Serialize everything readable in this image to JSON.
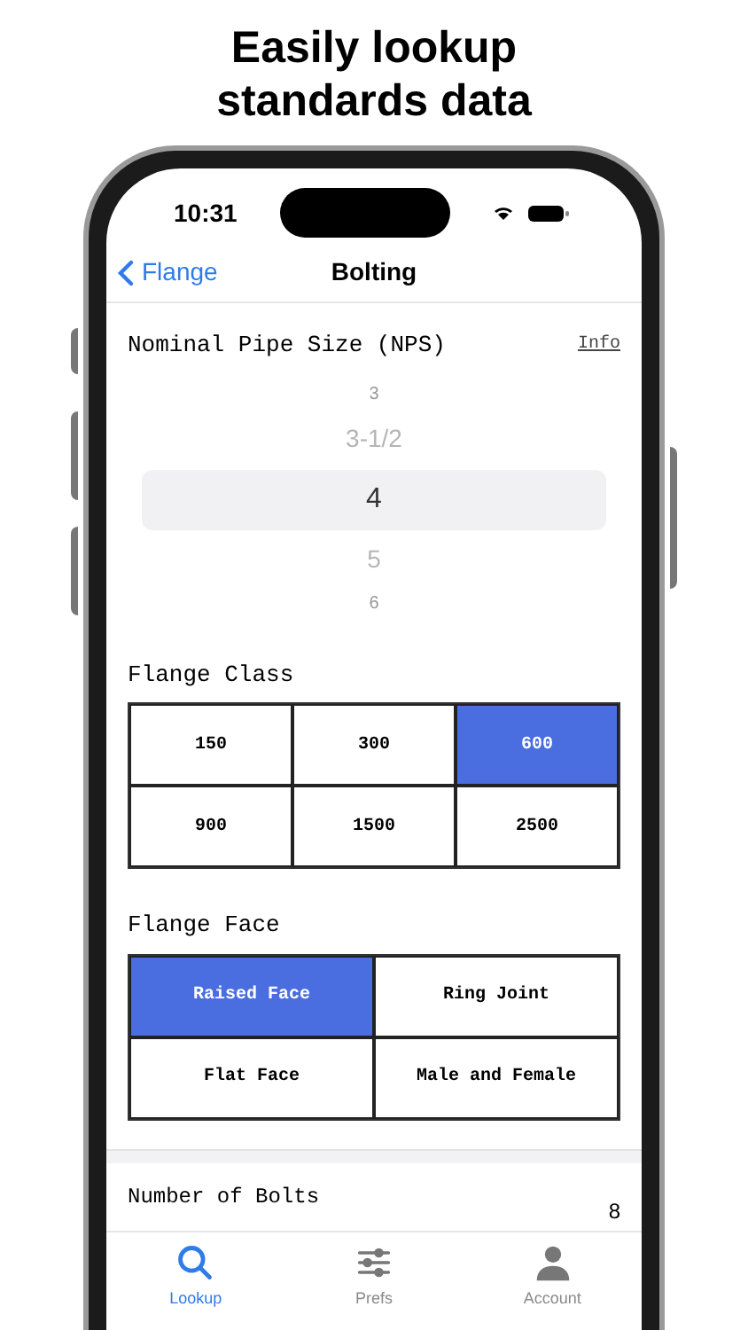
{
  "headline": "Easily lookup standards data",
  "status_bar": {
    "time": "10:31"
  },
  "nav": {
    "back": "Flange",
    "title": "Bolting"
  },
  "nps": {
    "label": "Nominal Pipe Size (NPS)",
    "info": "Info",
    "options": [
      {
        "label": "3",
        "selected": false
      },
      {
        "label": "3-1/2",
        "selected": false
      },
      {
        "label": "4",
        "selected": true
      },
      {
        "label": "5",
        "selected": false
      },
      {
        "label": "6",
        "selected": false
      }
    ]
  },
  "flange_class": {
    "label": "Flange Class",
    "options": [
      {
        "label": "150",
        "selected": false
      },
      {
        "label": "300",
        "selected": false
      },
      {
        "label": "600",
        "selected": true
      },
      {
        "label": "900",
        "selected": false
      },
      {
        "label": "1500",
        "selected": false
      },
      {
        "label": "2500",
        "selected": false
      }
    ]
  },
  "flange_face": {
    "label": "Flange Face",
    "options": [
      {
        "label": "Raised Face",
        "selected": true
      },
      {
        "label": "Ring Joint",
        "selected": false
      },
      {
        "label": "Flat Face",
        "selected": false
      },
      {
        "label": "Male and Female",
        "selected": false
      }
    ]
  },
  "result": {
    "label": "Number of Bolts",
    "value": "8"
  },
  "tab_bar": [
    {
      "kind": "search",
      "label": "Lookup",
      "selected": true
    },
    {
      "kind": "sliders",
      "label": "Prefs",
      "selected": false
    },
    {
      "kind": "person",
      "label": "Account",
      "selected": false
    }
  ]
}
